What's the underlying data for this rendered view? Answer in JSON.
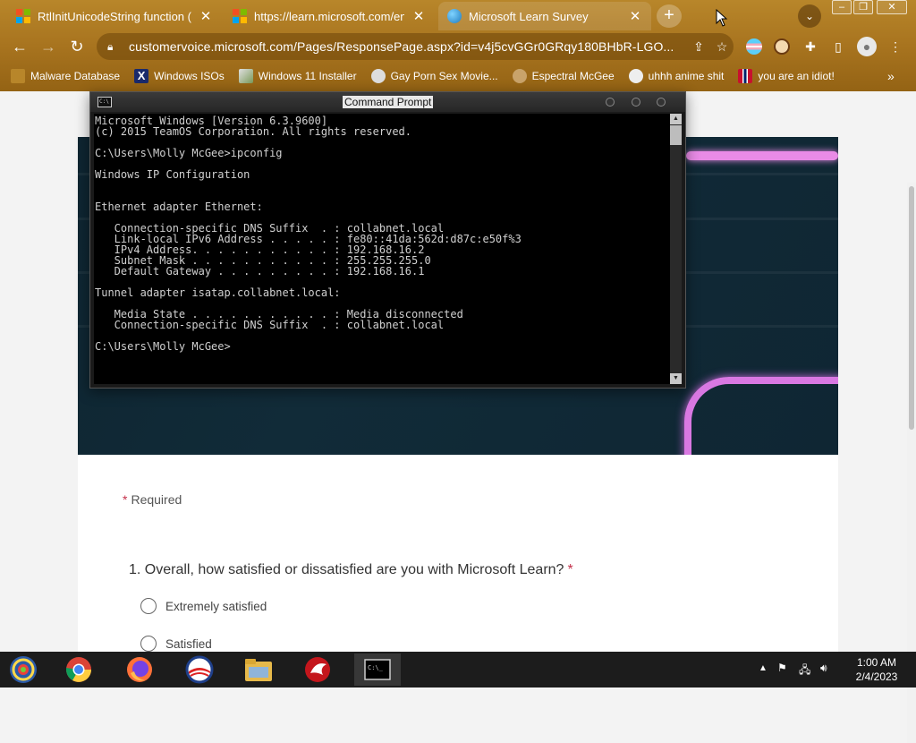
{
  "browser": {
    "tabs": [
      {
        "title": "RtlInitUnicodeString function (wdm.h)",
        "icon": "microsoft-icon"
      },
      {
        "title": "https://learn.microsoft.com/en-us/windows",
        "icon": "microsoft-icon"
      },
      {
        "title": "Microsoft Learn Survey",
        "icon": "globe-icon"
      }
    ],
    "new_tab": "+",
    "url": "customervoice.microsoft.com/Pages/ResponsePage.aspx?id=v4j5cvGGr0GRqy180BHbR-LGO...",
    "bookmarks": [
      {
        "label": "Malware Database"
      },
      {
        "label": "Windows ISOs"
      },
      {
        "label": "Windows 11 Installer"
      },
      {
        "label": "Gay Porn Sex Movie..."
      },
      {
        "label": "Espectral McGee"
      },
      {
        "label": "uhhh anime shit"
      },
      {
        "label": "you are an idiot!"
      }
    ],
    "bookmarks_overflow": "»",
    "theme_color": "#a8741f"
  },
  "survey": {
    "required_note": "Required",
    "question_1": "1. Overall, how satisfied or dissatisfied are you with Microsoft Learn?",
    "options": [
      "Extremely satisfied",
      "Satisfied"
    ]
  },
  "cmd": {
    "title": "Command Prompt",
    "output": "Microsoft Windows [Version 6.3.9600]\n(c) 2015 TeamOS Corporation. All rights reserved.\n\nC:\\Users\\Molly McGee>ipconfig\n\nWindows IP Configuration\n\n\nEthernet adapter Ethernet:\n\n   Connection-specific DNS Suffix  . : collabnet.local\n   Link-local IPv6 Address . . . . . : fe80::41da:562d:d87c:e50f%3\n   IPv4 Address. . . . . . . . . . . : 192.168.16.2\n   Subnet Mask . . . . . . . . . . . : 255.255.255.0\n   Default Gateway . . . . . . . . . : 192.168.16.1\n\nTunnel adapter isatap.collabnet.local:\n\n   Media State . . . . . . . . . . . : Media disconnected\n   Connection-specific DNS Suffix  . : collabnet.local\n\nC:\\Users\\Molly McGee>"
  },
  "taskbar": {
    "time": "1:00 AM",
    "date": "2/4/2023"
  }
}
